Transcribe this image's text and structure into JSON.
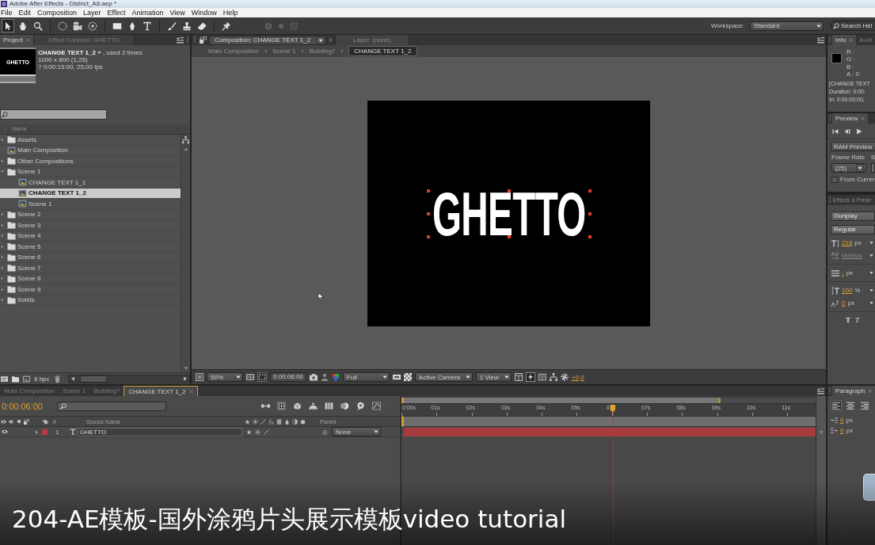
{
  "window": {
    "title": "Adobe After Effects - District_A8.aep *"
  },
  "menu": [
    "File",
    "Edit",
    "Composition",
    "Layer",
    "Effect",
    "Animation",
    "View",
    "Window",
    "Help"
  ],
  "toolbar": {
    "tool_groups": [
      [
        {
          "kind": "pointer",
          "selected": true
        },
        {
          "kind": "hand",
          "selected": false
        },
        {
          "kind": "zoom",
          "selected": false
        }
      ],
      [
        {
          "kind": "rotate",
          "selected": false
        },
        {
          "kind": "camera",
          "selected": false
        },
        {
          "kind": "pan",
          "selected": false
        }
      ],
      [
        {
          "kind": "rectangle",
          "selected": false
        },
        {
          "kind": "pen",
          "selected": false
        },
        {
          "kind": "type",
          "selected": false
        }
      ],
      [
        {
          "kind": "brush",
          "selected": false
        },
        {
          "kind": "stamp",
          "selected": false
        },
        {
          "kind": "eraser",
          "selected": false
        }
      ],
      [
        {
          "kind": "pin",
          "selected": false
        }
      ]
    ],
    "axis_modes": [
      {
        "kind": "local",
        "disabled": true
      },
      {
        "kind": "world",
        "disabled": true
      },
      {
        "kind": "view",
        "disabled": true
      }
    ],
    "workspace_label": "Workspace:",
    "workspace": "Standard",
    "search": {
      "placeholder": "Search Hel"
    }
  },
  "project": {
    "tabs": [
      {
        "label": "Project",
        "selected": true
      },
      {
        "label": "Effect Controls: GHETTO",
        "selected": false
      }
    ],
    "thumbnail_text": "GHETTO",
    "name": "CHANGE TEXT 1_2",
    "usage": ", used 2 times",
    "size": "1000 x 800 (1,25)",
    "duration": "? 0:00:15:00, 25,00 fps",
    "column": "Name",
    "items": [
      {
        "kind": "folder",
        "name": "Assets",
        "expanded": false,
        "selected": false
      },
      {
        "kind": "comp",
        "name": "Main Composition",
        "selected": false
      },
      {
        "kind": "folder",
        "name": "Other Compositions",
        "expanded": false,
        "selected": false
      },
      {
        "kind": "folder",
        "name": "Scene 1",
        "expanded": true,
        "selected": false,
        "children": [
          {
            "kind": "comp",
            "name": "CHANGE TEXT 1_1",
            "selected": false
          },
          {
            "kind": "comp",
            "name": "CHANGE TEXT 1_2",
            "selected": true
          },
          {
            "kind": "comp",
            "name": "Scene 1",
            "selected": false
          }
        ]
      },
      {
        "kind": "folder",
        "name": "Scene 2",
        "expanded": false,
        "selected": false
      },
      {
        "kind": "folder",
        "name": "Scene 3",
        "expanded": false,
        "selected": false
      },
      {
        "kind": "folder",
        "name": "Scene 4",
        "expanded": false,
        "selected": false
      },
      {
        "kind": "folder",
        "name": "Scene 5",
        "expanded": false,
        "selected": false
      },
      {
        "kind": "folder",
        "name": "Scene 6",
        "expanded": false,
        "selected": false
      },
      {
        "kind": "folder",
        "name": "Scene 7",
        "expanded": false,
        "selected": false
      },
      {
        "kind": "folder",
        "name": "Scene 8",
        "expanded": false,
        "selected": false
      },
      {
        "kind": "folder",
        "name": "Scene 9",
        "expanded": false,
        "selected": false
      },
      {
        "kind": "folder",
        "name": "Solids",
        "expanded": false,
        "selected": false
      }
    ],
    "bpc": "8 bpc"
  },
  "composition": {
    "tabs": [
      {
        "label": "Composition: CHANGE TEXT 1_2",
        "selected": true
      },
      {
        "label": "Layer: (none)",
        "selected": false
      }
    ],
    "breadcrumbs": [
      {
        "label": "Main Composition",
        "selected": false
      },
      {
        "label": "Scene 1",
        "selected": false
      },
      {
        "label": "Building7",
        "selected": false
      },
      {
        "label": "CHANGE TEXT 1_2",
        "selected": true
      }
    ],
    "canvas_text": "GHETTO",
    "zoom": "50%",
    "timecode": "0:00:06:00",
    "resolution": "Full",
    "camera": "Active Camera",
    "views": "1 View",
    "exposure": "+0,0"
  },
  "info": {
    "tabs": [
      {
        "label": "Info",
        "selected": true
      },
      {
        "label": "Audi",
        "selected": false
      }
    ],
    "channels": [
      "R :",
      "G :",
      "B :",
      "A : 0"
    ],
    "lines": [
      "[CHANGE TEXT",
      "Duration: 0:00:",
      "In: 0:00:00:00,"
    ]
  },
  "preview": {
    "tabs": [
      {
        "label": "Preview",
        "selected": true
      }
    ],
    "ram_button": "RAM Preview",
    "frame_rate_label": "Frame Rate",
    "skip_label": "S",
    "frame_rate": "(25)",
    "from_current": {
      "label": "From Curren",
      "checked": false
    }
  },
  "character": {
    "tabs": [
      {
        "label": "Effects & Prese",
        "selected": false
      }
    ],
    "font": "Gunplay",
    "style": "Regular",
    "size": "218",
    "size_unit": "px",
    "kerning": "Metrics",
    "leading": "-",
    "leading_unit": "px",
    "vertical_scale": "100",
    "vertical_scale_unit": "%",
    "baseline_shift": "0",
    "baseline_unit": "px",
    "styles": [
      {
        "kind": "bold",
        "label": "T"
      },
      {
        "kind": "italic",
        "label": "T"
      }
    ]
  },
  "timeline": {
    "tabs": [
      {
        "label": "Main Composition",
        "selected": false
      },
      {
        "label": "Scene 1",
        "selected": false
      },
      {
        "label": "Building7",
        "selected": false
      },
      {
        "label": "CHANGE TEXT 1_2",
        "selected": true
      }
    ],
    "timecode": "0:00:06:00",
    "ruler": [
      "0:00s",
      "01s",
      "02s",
      "03s",
      "04s",
      "05s",
      "0",
      "07s",
      "08s",
      "09s",
      "10s",
      "11s"
    ],
    "work_area": {
      "level": 0.77
    },
    "playhead": {
      "level": 0.51
    },
    "columns": {
      "number": "#",
      "source": "Source Name",
      "parent": "Parent"
    },
    "layers": [
      {
        "index": "1",
        "name": "GHETTO",
        "parent": "None",
        "color": "#b83a3a"
      }
    ]
  },
  "paragraph": {
    "tabs": [
      {
        "label": "Paragraph",
        "selected": true
      }
    ],
    "align": [
      {
        "kind": "left",
        "selected": true
      },
      {
        "kind": "center",
        "selected": false
      },
      {
        "kind": "right",
        "selected": false
      }
    ],
    "indents": [
      {
        "value": "0",
        "unit": "px"
      },
      {
        "value": "0",
        "unit": "px"
      }
    ]
  },
  "caption": "204-AE模板-国外涂鸦片头展示模板video tutorial"
}
